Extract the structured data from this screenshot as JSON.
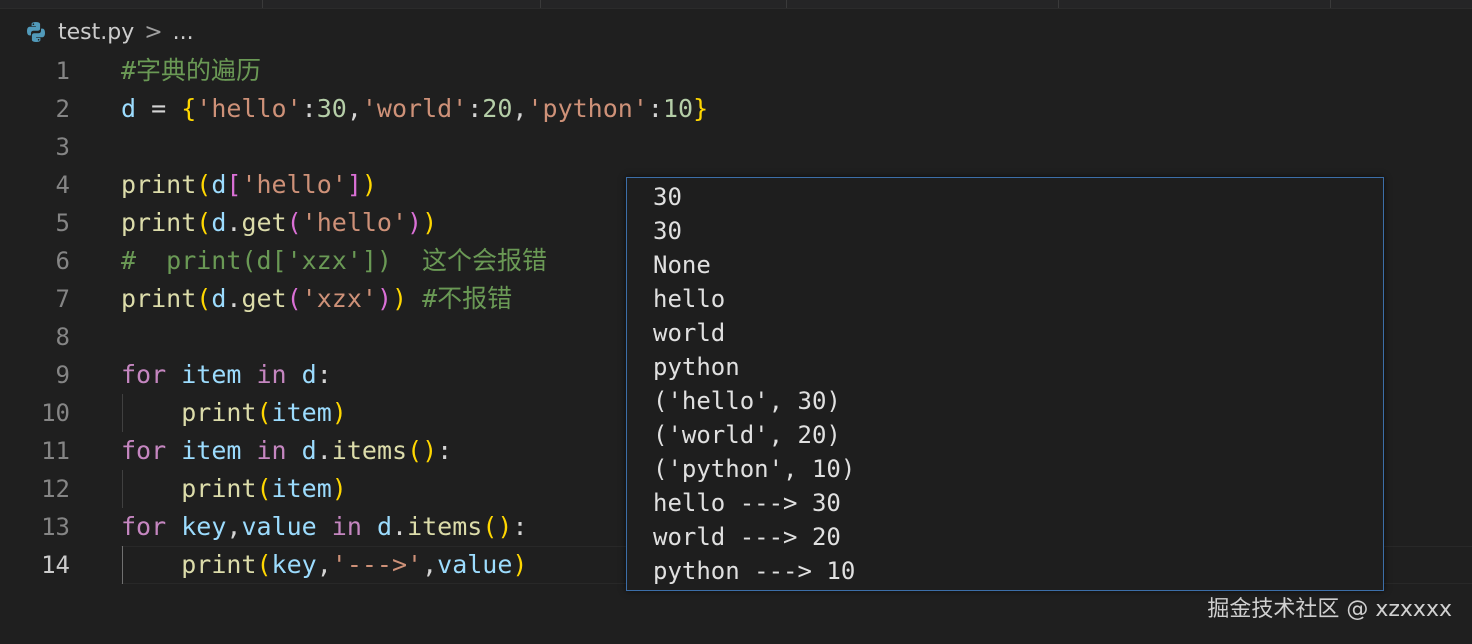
{
  "breadcrumb": {
    "file": "test.py",
    "separator": ">",
    "more": "..."
  },
  "code_lines": [
    {
      "number": "1",
      "tokens": [
        {
          "t": "#字典的遍历",
          "c": "c-comment"
        }
      ]
    },
    {
      "number": "2",
      "tokens": [
        {
          "t": "d",
          "c": "c-var"
        },
        {
          "t": " = ",
          "c": "c-op"
        },
        {
          "t": "{",
          "c": "b1"
        },
        {
          "t": "'hello'",
          "c": "c-str"
        },
        {
          "t": ":",
          "c": "c-op"
        },
        {
          "t": "30",
          "c": "c-num"
        },
        {
          "t": ",",
          "c": "c-op"
        },
        {
          "t": "'world'",
          "c": "c-str"
        },
        {
          "t": ":",
          "c": "c-op"
        },
        {
          "t": "20",
          "c": "c-num"
        },
        {
          "t": ",",
          "c": "c-op"
        },
        {
          "t": "'python'",
          "c": "c-str"
        },
        {
          "t": ":",
          "c": "c-op"
        },
        {
          "t": "10",
          "c": "c-num"
        },
        {
          "t": "}",
          "c": "b1"
        }
      ]
    },
    {
      "number": "3",
      "tokens": []
    },
    {
      "number": "4",
      "tokens": [
        {
          "t": "print",
          "c": "c-func"
        },
        {
          "t": "(",
          "c": "b1"
        },
        {
          "t": "d",
          "c": "c-var"
        },
        {
          "t": "[",
          "c": "b2"
        },
        {
          "t": "'hello'",
          "c": "c-str"
        },
        {
          "t": "]",
          "c": "b2"
        },
        {
          "t": ")",
          "c": "b1"
        }
      ]
    },
    {
      "number": "5",
      "tokens": [
        {
          "t": "print",
          "c": "c-func"
        },
        {
          "t": "(",
          "c": "b1"
        },
        {
          "t": "d",
          "c": "c-var"
        },
        {
          "t": ".",
          "c": "c-op"
        },
        {
          "t": "get",
          "c": "c-func"
        },
        {
          "t": "(",
          "c": "b2"
        },
        {
          "t": "'hello'",
          "c": "c-str"
        },
        {
          "t": ")",
          "c": "b2"
        },
        {
          "t": ")",
          "c": "b1"
        }
      ]
    },
    {
      "number": "6",
      "tokens": [
        {
          "t": "#  print(d['xzx'])  这个会报错",
          "c": "c-comment"
        }
      ]
    },
    {
      "number": "7",
      "tokens": [
        {
          "t": "print",
          "c": "c-func"
        },
        {
          "t": "(",
          "c": "b1"
        },
        {
          "t": "d",
          "c": "c-var"
        },
        {
          "t": ".",
          "c": "c-op"
        },
        {
          "t": "get",
          "c": "c-func"
        },
        {
          "t": "(",
          "c": "b2"
        },
        {
          "t": "'xzx'",
          "c": "c-str"
        },
        {
          "t": ")",
          "c": "b2"
        },
        {
          "t": ")",
          "c": "b1"
        },
        {
          "t": " ",
          "c": "c-op"
        },
        {
          "t": "#不报错",
          "c": "c-comment"
        }
      ]
    },
    {
      "number": "8",
      "tokens": []
    },
    {
      "number": "9",
      "tokens": [
        {
          "t": "for",
          "c": "c-kw"
        },
        {
          "t": " ",
          "c": "c-op"
        },
        {
          "t": "item",
          "c": "c-var"
        },
        {
          "t": " ",
          "c": "c-op"
        },
        {
          "t": "in",
          "c": "c-kw"
        },
        {
          "t": " ",
          "c": "c-op"
        },
        {
          "t": "d",
          "c": "c-var"
        },
        {
          "t": ":",
          "c": "c-op"
        }
      ]
    },
    {
      "number": "10",
      "tokens": [
        {
          "t": "    ",
          "c": "c-op"
        },
        {
          "t": "print",
          "c": "c-func"
        },
        {
          "t": "(",
          "c": "b1"
        },
        {
          "t": "item",
          "c": "c-var"
        },
        {
          "t": ")",
          "c": "b1"
        }
      ]
    },
    {
      "number": "11",
      "tokens": [
        {
          "t": "for",
          "c": "c-kw"
        },
        {
          "t": " ",
          "c": "c-op"
        },
        {
          "t": "item",
          "c": "c-var"
        },
        {
          "t": " ",
          "c": "c-op"
        },
        {
          "t": "in",
          "c": "c-kw"
        },
        {
          "t": " ",
          "c": "c-op"
        },
        {
          "t": "d",
          "c": "c-var"
        },
        {
          "t": ".",
          "c": "c-op"
        },
        {
          "t": "items",
          "c": "c-func"
        },
        {
          "t": "()",
          "c": "b1"
        },
        {
          "t": ":",
          "c": "c-op"
        }
      ]
    },
    {
      "number": "12",
      "tokens": [
        {
          "t": "    ",
          "c": "c-op"
        },
        {
          "t": "print",
          "c": "c-func"
        },
        {
          "t": "(",
          "c": "b1"
        },
        {
          "t": "item",
          "c": "c-var"
        },
        {
          "t": ")",
          "c": "b1"
        }
      ]
    },
    {
      "number": "13",
      "tokens": [
        {
          "t": "for",
          "c": "c-kw"
        },
        {
          "t": " ",
          "c": "c-op"
        },
        {
          "t": "key",
          "c": "c-var"
        },
        {
          "t": ",",
          "c": "c-op"
        },
        {
          "t": "value",
          "c": "c-var"
        },
        {
          "t": " ",
          "c": "c-op"
        },
        {
          "t": "in",
          "c": "c-kw"
        },
        {
          "t": " ",
          "c": "c-op"
        },
        {
          "t": "d",
          "c": "c-var"
        },
        {
          "t": ".",
          "c": "c-op"
        },
        {
          "t": "items",
          "c": "c-func"
        },
        {
          "t": "()",
          "c": "b1"
        },
        {
          "t": ":",
          "c": "c-op"
        }
      ]
    },
    {
      "number": "14",
      "tokens": [
        {
          "t": "    ",
          "c": "c-op"
        },
        {
          "t": "print",
          "c": "c-func"
        },
        {
          "t": "(",
          "c": "b1"
        },
        {
          "t": "key",
          "c": "c-var"
        },
        {
          "t": ",",
          "c": "c-op"
        },
        {
          "t": "'--->'",
          "c": "c-str"
        },
        {
          "t": ",",
          "c": "c-op"
        },
        {
          "t": "value",
          "c": "c-var"
        },
        {
          "t": ")",
          "c": "b1"
        }
      ]
    }
  ],
  "active_line": "14",
  "output_lines": [
    "30",
    "30",
    "None",
    "hello",
    "world",
    "python",
    "('hello', 30)",
    "('world', 20)",
    "('python', 10)",
    "hello ---> 30",
    "world ---> 20",
    "python ---> 10"
  ],
  "watermark": "掘金技术社区 @ xzxxxx"
}
